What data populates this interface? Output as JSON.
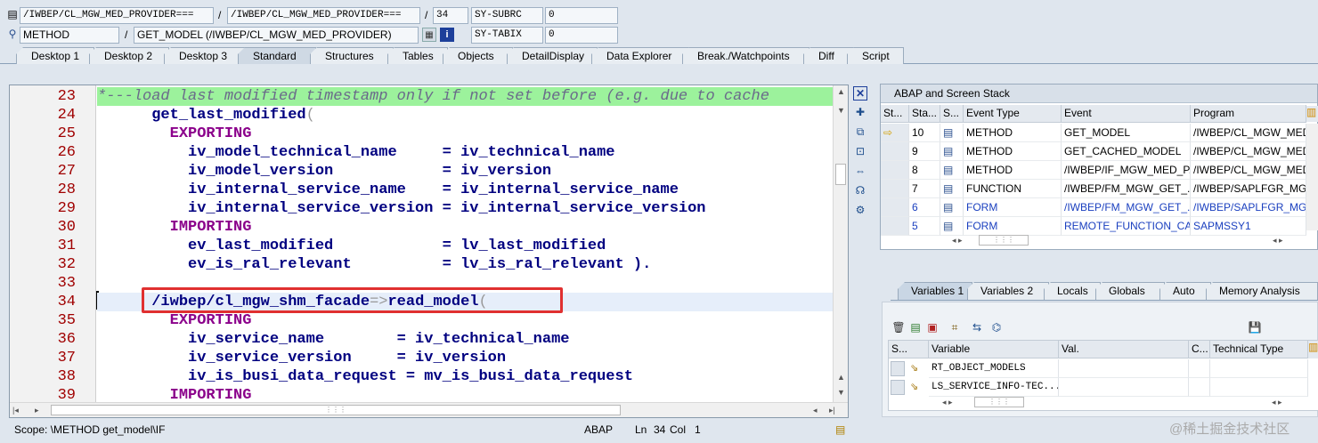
{
  "top_fields": {
    "row1": {
      "field1": "/IWBEP/CL_MGW_MED_PROVIDER===",
      "sep": "/",
      "field2": "/IWBEP/CL_MGW_MED_PROVIDER===",
      "sep2": "/",
      "line": "34",
      "sysvar": "SY-SUBRC",
      "sysval": "0"
    },
    "row2": {
      "type": "METHOD",
      "sep": "/",
      "name": "GET_MODEL (/IWBEP/CL_MGW_MED_PROVIDER)",
      "sysvar": "SY-TABIX",
      "sysval": "0"
    }
  },
  "tabs": [
    "Desktop 1",
    "Desktop 2",
    "Desktop 3",
    "Standard",
    "Structures",
    "Tables",
    "Objects",
    "DetailDisplay",
    "Data Explorer",
    "Break./Watchpoints",
    "Diff",
    "Script"
  ],
  "active_tab": "Standard",
  "editor": {
    "lines": [
      {
        "no": "23",
        "text": "*---load last modified timestamp only if not set before (e.g. due to cache"
      },
      {
        "no": "24",
        "text": "      get_last_modified("
      },
      {
        "no": "25",
        "text": "        EXPORTING"
      },
      {
        "no": "26",
        "text": "          iv_model_technical_name     = iv_technical_name"
      },
      {
        "no": "27",
        "text": "          iv_model_version            = iv_version"
      },
      {
        "no": "28",
        "text": "          iv_internal_service_name    = iv_internal_service_name"
      },
      {
        "no": "29",
        "text": "          iv_internal_service_version = iv_internal_service_version"
      },
      {
        "no": "30",
        "text": "        IMPORTING"
      },
      {
        "no": "31",
        "text": "          ev_last_modified            = lv_last_modified"
      },
      {
        "no": "32",
        "text": "          ev_is_ral_relevant          = lv_is_ral_relevant )."
      },
      {
        "no": "33",
        "text": ""
      },
      {
        "no": "34",
        "text": "      /iwbep/cl_mgw_shm_facade=>read_model("
      },
      {
        "no": "35",
        "text": "        EXPORTING"
      },
      {
        "no": "36",
        "text": "          iv_service_name        = iv_technical_name"
      },
      {
        "no": "37",
        "text": "          iv_service_version     = iv_version"
      },
      {
        "no": "38",
        "text": "          iv_is_busi_data_request = mv_is_busi_data_request"
      },
      {
        "no": "39",
        "text": "        IMPORTING"
      }
    ],
    "current_line": "34"
  },
  "stack": {
    "title": "ABAP and Screen Stack",
    "columns": [
      "St...",
      "Sta...",
      "S...",
      "Event Type",
      "Event",
      "Program"
    ],
    "rows": [
      {
        "level": "10",
        "type": "METHOD",
        "event": "GET_MODEL",
        "program": "/IWBEP/CL_MGW_MED_",
        "blue": false,
        "current": true
      },
      {
        "level": "9",
        "type": "METHOD",
        "event": "GET_CACHED_MODEL",
        "program": "/IWBEP/CL_MGW_MED_",
        "blue": false,
        "current": false
      },
      {
        "level": "8",
        "type": "METHOD",
        "event": "/IWBEP/IF_MGW_MED_P...",
        "program": "/IWBEP/CL_MGW_MED_",
        "blue": false,
        "current": false
      },
      {
        "level": "7",
        "type": "FUNCTION",
        "event": "/IWBEP/FM_MGW_GET_...",
        "program": "/IWBEP/SAPLFGR_MGW",
        "blue": false,
        "current": false
      },
      {
        "level": "6",
        "type": "FORM",
        "event": "/IWBEP/FM_MGW_GET_...",
        "program": "/IWBEP/SAPLFGR_MGW",
        "blue": true,
        "current": false
      },
      {
        "level": "5",
        "type": "FORM",
        "event": "REMOTE_FUNCTION_CA...",
        "program": "SAPMSSY1",
        "blue": true,
        "current": false
      }
    ]
  },
  "var_tabs": [
    "Variables 1",
    "Variables 2",
    "Locals",
    "Globals",
    "Auto",
    "Memory Analysis"
  ],
  "active_var_tab": "Variables 1",
  "variables": {
    "columns": [
      "S...",
      "Variable",
      "Val.",
      "C...",
      "Technical Type"
    ],
    "rows": [
      {
        "name": "RT_OBJECT_MODELS",
        "value": "",
        "type": ""
      },
      {
        "name": "LS_SERVICE_INFO-TEC...",
        "value": "",
        "type": ""
      }
    ]
  },
  "status_bar": {
    "scope": "Scope: \\METHOD get_model\\IF",
    "lang": "ABAP",
    "ln_label": "Ln",
    "ln": "34",
    "col_label": "Col",
    "col": "1"
  },
  "watermark": "@稀土掘金技术社区"
}
